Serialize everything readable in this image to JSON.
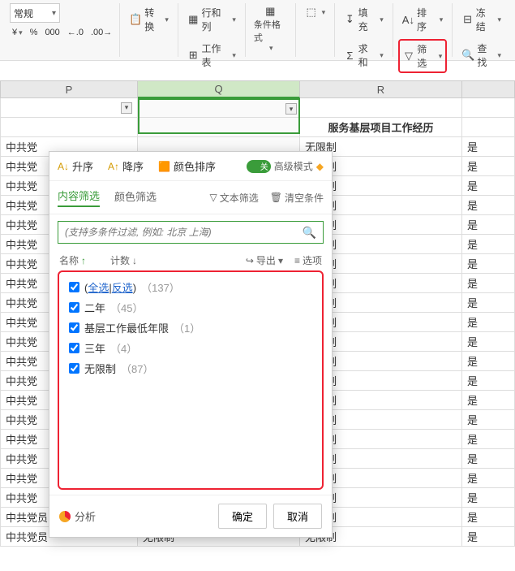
{
  "ribbon": {
    "format": "常规",
    "convert": "转换",
    "rowscols": "行和列",
    "worksheet": "工作表",
    "condfmt": "条件格式",
    "fill": "填充",
    "sort": "排序",
    "freeze": "冻结",
    "sum": "求和",
    "filter": "筛选",
    "find": "查找",
    "numfmt": {
      "currency": "¥",
      "percent": "%",
      "comma": "000",
      "dec_inc": ".0←",
      "dec_dec": ".00→"
    }
  },
  "columns": {
    "p": "P",
    "q": "Q",
    "r": "R"
  },
  "header_row": {
    "r": "服务基层项目工作经历"
  },
  "rows_p_prefix": "中共党",
  "rows_p_full": "中共党员",
  "rows_q": "无限制",
  "rows_r": "无限制",
  "rows_s": "是",
  "filter_panel": {
    "asc": "升序",
    "desc": "降序",
    "color_sort": "颜色排序",
    "adv": "高级模式",
    "tab_content": "内容筛选",
    "tab_color": "颜色筛选",
    "text_filter": "文本筛选",
    "clear": "清空条件",
    "search_placeholder": "(支持多条件过滤, 例如: 北京 上海)",
    "name_hdr": "名称",
    "count_hdr": "计数",
    "export": "导出",
    "options": "选项",
    "select_all": "全选",
    "invert": "反选",
    "items": [
      {
        "label_all_count": "（137）"
      },
      {
        "label": "二年",
        "count": "（45）"
      },
      {
        "label": "基层工作最低年限",
        "count": "（1）"
      },
      {
        "label": "三年",
        "count": "（4）"
      },
      {
        "label": "无限制",
        "count": "（87）"
      }
    ],
    "analysis": "分析",
    "ok": "确定",
    "cancel": "取消"
  }
}
